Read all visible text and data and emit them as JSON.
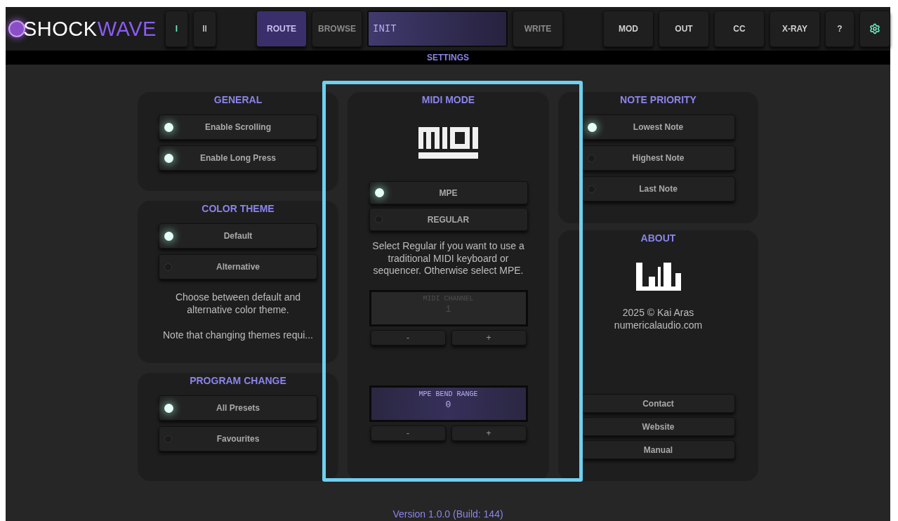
{
  "logo": {
    "first": "SHOCK",
    "second": "WAVE"
  },
  "toolbar": [
    {
      "kind": "transport",
      "label": "I",
      "on": true
    },
    {
      "kind": "transport",
      "label": "II",
      "on": false
    },
    {
      "kind": "gap"
    },
    {
      "kind": "button",
      "label": "ROUTE",
      "selected": true,
      "disabled": false
    },
    {
      "kind": "button",
      "label": "BROWSE",
      "selected": false,
      "disabled": true
    },
    {
      "kind": "display",
      "label": "INIT"
    },
    {
      "kind": "button",
      "label": "WRITE",
      "selected": false,
      "disabled": true
    },
    {
      "kind": "gap"
    },
    {
      "kind": "button",
      "label": "MOD",
      "selected": false,
      "disabled": false
    },
    {
      "kind": "button",
      "label": "OUT",
      "selected": false,
      "disabled": false
    },
    {
      "kind": "button",
      "label": "CC",
      "selected": false,
      "disabled": false
    },
    {
      "kind": "button",
      "label": "X-RAY",
      "selected": false,
      "disabled": false
    },
    {
      "kind": "small",
      "label": "?",
      "selected": false,
      "disabled": false
    },
    {
      "kind": "settings"
    }
  ],
  "page_title": "SETTINGS",
  "general": {
    "title": "GENERAL",
    "options": [
      {
        "label": "Enable Scrolling",
        "on": true
      },
      {
        "label": "Enable Long Press",
        "on": true
      }
    ]
  },
  "color_theme": {
    "title": "COLOR THEME",
    "options": [
      {
        "label": "Default",
        "selected": true
      },
      {
        "label": "Alternative",
        "selected": false
      }
    ],
    "description": "Choose between default and alternative color theme.",
    "note": "Note that changing themes requi..."
  },
  "program_change": {
    "title": "PROGRAM CHANGE",
    "options": [
      {
        "label": "All Presets",
        "selected": true
      },
      {
        "label": "Favourites",
        "selected": false
      }
    ]
  },
  "midi_mode": {
    "title": "MIDI MODE",
    "options": [
      {
        "label": "MPE",
        "selected": true
      },
      {
        "label": "REGULAR",
        "selected": false
      }
    ],
    "description": "Select Regular if you want to use a traditional MIDI keyboard or sequencer. Otherwise select MPE.",
    "displays": [
      {
        "label": "MIDI CHANNEL",
        "value": "1",
        "enabled": false,
        "buttons": [
          "-",
          "+"
        ]
      },
      {
        "label": "MPE BEND RANGE",
        "value": "0",
        "enabled": true,
        "buttons": [
          "-",
          "+"
        ]
      }
    ]
  },
  "note_priority": {
    "title": "NOTE PRIORITY",
    "options": [
      {
        "label": "Lowest Note",
        "selected": true
      },
      {
        "label": "Highest Note",
        "selected": false
      },
      {
        "label": "Last Note",
        "selected": false
      }
    ]
  },
  "about": {
    "title": "ABOUT",
    "copyright": "2025 © Kai Aras",
    "website": "numericalaudio.com",
    "links": [
      "Contact",
      "Website",
      "Manual"
    ]
  },
  "version": "Version 1.0.0 (Build: 144)"
}
